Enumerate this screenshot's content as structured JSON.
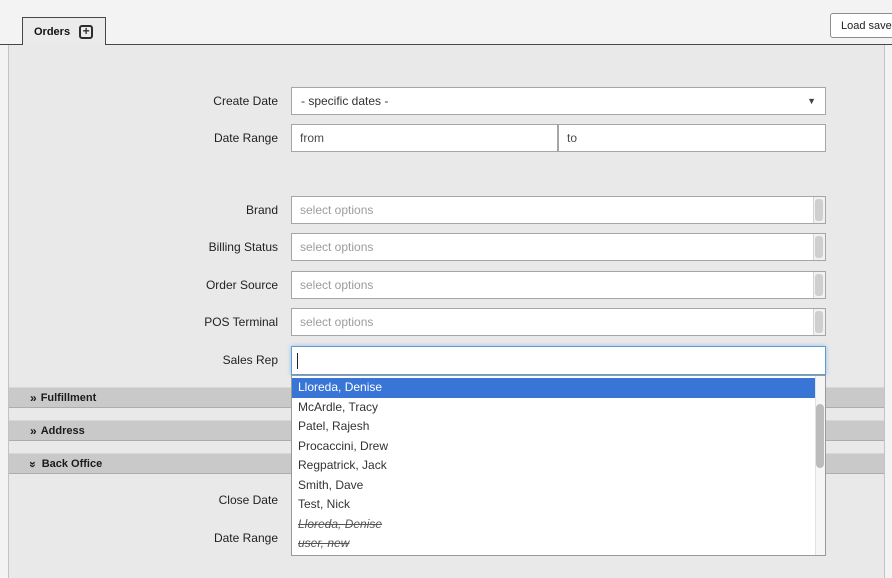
{
  "tabs": {
    "orders_label": "Orders",
    "add_tab_icon": "+"
  },
  "toolbar": {
    "load_saved_label": "Load saved"
  },
  "filters": {
    "create_date": {
      "label": "Create Date",
      "value": "- specific dates -"
    },
    "date_range": {
      "label": "Date Range",
      "from_placeholder": "from",
      "to_placeholder": "to"
    },
    "brand": {
      "label": "Brand",
      "placeholder": "select options"
    },
    "billing_status": {
      "label": "Billing Status",
      "placeholder": "select options"
    },
    "order_source": {
      "label": "Order Source",
      "placeholder": "select options"
    },
    "pos_terminal": {
      "label": "POS Terminal",
      "placeholder": "select options"
    },
    "sales_rep": {
      "label": "Sales Rep",
      "value": ""
    }
  },
  "dropdown": {
    "items": [
      {
        "label": "Lloreda, Denise",
        "state": "highlighted"
      },
      {
        "label": "McArdle, Tracy",
        "state": "normal"
      },
      {
        "label": "Patel, Rajesh",
        "state": "normal"
      },
      {
        "label": "Procaccini, Drew",
        "state": "normal"
      },
      {
        "label": "Regpatrick, Jack",
        "state": "normal"
      },
      {
        "label": "Smith, Dave",
        "state": "normal"
      },
      {
        "label": "Test, Nick",
        "state": "normal"
      },
      {
        "label": "Lloreda, Denise",
        "state": "inactive"
      },
      {
        "label": "user, new",
        "state": "inactive"
      }
    ]
  },
  "sections": [
    {
      "label": "Fulfillment",
      "state": "collapsed"
    },
    {
      "label": "Address",
      "state": "collapsed"
    },
    {
      "label": "Back Office",
      "state": "expanded"
    }
  ],
  "back_office": {
    "close_date_label": "Close Date",
    "date_range_label": "Date Range"
  },
  "colors": {
    "dropdown_highlight": "#3875d7",
    "focus_border": "#5b9dd9",
    "section_bar": "#c9c9c9"
  }
}
